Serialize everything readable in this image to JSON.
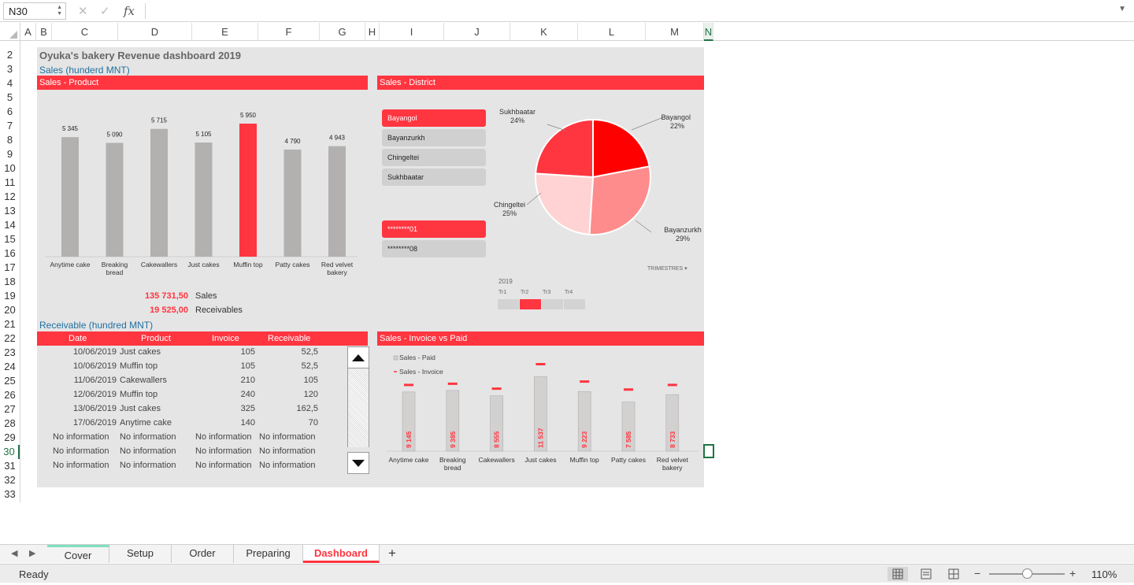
{
  "formula_bar": {
    "name_box": "N30",
    "fx": "fx",
    "cancel_symbol": "✕",
    "enter_symbol": "✓"
  },
  "columns": [
    "A",
    "B",
    "C",
    "D",
    "E",
    "F",
    "G",
    "H",
    "I",
    "J",
    "K",
    "L",
    "M",
    "N"
  ],
  "rows": [
    "2",
    "3",
    "4",
    "5",
    "6",
    "7",
    "8",
    "9",
    "10",
    "11",
    "12",
    "13",
    "14",
    "15",
    "16",
    "17",
    "18",
    "19",
    "20",
    "21",
    "22",
    "23",
    "24",
    "25",
    "26",
    "27",
    "28",
    "29",
    "30",
    "31",
    "32",
    "33"
  ],
  "selected": {
    "column": "N",
    "row": "30"
  },
  "dashboard": {
    "title": "Oyuka's bakery Revenue dashboard 2019",
    "sales_subtitle": "Sales (hunderd MNT)",
    "receivable_subtitle": "Receivable (hundred MNT)",
    "product_section": "Sales - Product",
    "district_section": "Sales - District",
    "invoice_section": "Sales - Invoice vs Paid",
    "totals": [
      {
        "value": "135 731,50",
        "label": "Sales"
      },
      {
        "value": "19 525,00",
        "label": "Receivables"
      }
    ]
  },
  "product_chart": {
    "type": "bar",
    "categories": [
      "Anytime cake",
      "Breaking bread",
      "Cakewallers",
      "Just cakes",
      "Muffin top",
      "Patty cakes",
      "Red velvet bakery"
    ],
    "category_lines": [
      [
        "Anytime cake"
      ],
      [
        "Breaking",
        "bread"
      ],
      [
        "Cakewallers"
      ],
      [
        "Just cakes"
      ],
      [
        "Muffin top"
      ],
      [
        "Patty cakes"
      ],
      [
        "Red velvet",
        "bakery"
      ]
    ],
    "values": [
      5345,
      5090,
      5715,
      5105,
      5950,
      4790,
      4943
    ],
    "value_labels": [
      "5 345",
      "5 090",
      "5 715",
      "5 105",
      "5 950",
      "4 790",
      "4 943"
    ],
    "highlight_index": 4,
    "bar_color": "#b3b0b0",
    "highlight_color": "#ff3540",
    "ylim": [
      0,
      7000
    ]
  },
  "district_slicer": {
    "items": [
      {
        "label": "Bayangol",
        "active": true
      },
      {
        "label": "Bayanzurkh",
        "active": false
      },
      {
        "label": "Chingeltei",
        "active": false
      },
      {
        "label": "Sukhbaatar",
        "active": false
      }
    ]
  },
  "id_slicer": {
    "items": [
      {
        "label": "********01",
        "active": true
      },
      {
        "label": "********08",
        "active": false
      }
    ]
  },
  "pie_chart": {
    "type": "pie",
    "slices": [
      {
        "name": "Bayangol",
        "pct": 22,
        "label": "22%",
        "color": "#ff0000"
      },
      {
        "name": "Bayanzurkh",
        "pct": 29,
        "label": "29%",
        "color": "#ff8c8c"
      },
      {
        "name": "Chingeltei",
        "pct": 25,
        "label": "25%",
        "color": "#ffd3d3"
      },
      {
        "name": "Sukhbaatar",
        "pct": 24,
        "label": "24%",
        "color": "#ff3540"
      }
    ]
  },
  "timeline": {
    "heading": "TRIMESTRES",
    "year": "2019",
    "quarters": [
      "Tr1",
      "Tr2",
      "Tr3",
      "Tr4"
    ],
    "active_index": 1
  },
  "receivable_table": {
    "headers": [
      "Date",
      "Product",
      "Invoice",
      "Receivable"
    ],
    "rows": [
      [
        "10/06/2019",
        "Just cakes",
        "105",
        "52,5"
      ],
      [
        "10/06/2019",
        "Muffin top",
        "105",
        "52,5"
      ],
      [
        "11/06/2019",
        "Cakewallers",
        "210",
        "105"
      ],
      [
        "12/06/2019",
        "Muffin top",
        "240",
        "120"
      ],
      [
        "13/06/2019",
        "Just cakes",
        "325",
        "162,5"
      ],
      [
        "17/06/2019",
        "Anytime cake",
        "140",
        "70"
      ],
      [
        "No information",
        "No information",
        "No information",
        "No information"
      ],
      [
        "No information",
        "No information",
        "No information",
        "No information"
      ],
      [
        "No information",
        "No information",
        "No information",
        "No information"
      ]
    ]
  },
  "invoice_chart": {
    "type": "bar",
    "legend": [
      "Sales - Paid",
      "Sales - Invoice"
    ],
    "categories": [
      "Anytime cake",
      "Breaking bread",
      "Cakewallers",
      "Just cakes",
      "Muffin top",
      "Patty cakes",
      "Red velvet bakery"
    ],
    "category_lines": [
      [
        "Anytime cake"
      ],
      [
        "Breaking",
        "bread"
      ],
      [
        "Cakewallers"
      ],
      [
        "Just cakes"
      ],
      [
        "Muffin top"
      ],
      [
        "Patty cakes"
      ],
      [
        "Red velvet",
        "bakery"
      ]
    ],
    "paid": [
      9145,
      9385,
      8555,
      11537,
      9223,
      7585,
      8733
    ],
    "paid_labels": [
      "9 145",
      "9 385",
      "8 555",
      "11 537",
      "9 223",
      "7 585",
      "8 733"
    ],
    "invoice": [
      10290,
      10475,
      9715,
      13500,
      10815,
      9580,
      10290
    ],
    "ylim": [
      0,
      15500
    ],
    "paid_color": "#d3d0d0",
    "invoice_color": "#ff3540"
  },
  "sheet_tabs": [
    "Cover",
    "Setup",
    "Order",
    "Preparing",
    "Dashboard"
  ],
  "active_tab": "Dashboard",
  "add_sheet": "+",
  "status": {
    "text": "Ready",
    "zoom": "110%",
    "zoom_minus": "−",
    "zoom_plus": "+"
  }
}
